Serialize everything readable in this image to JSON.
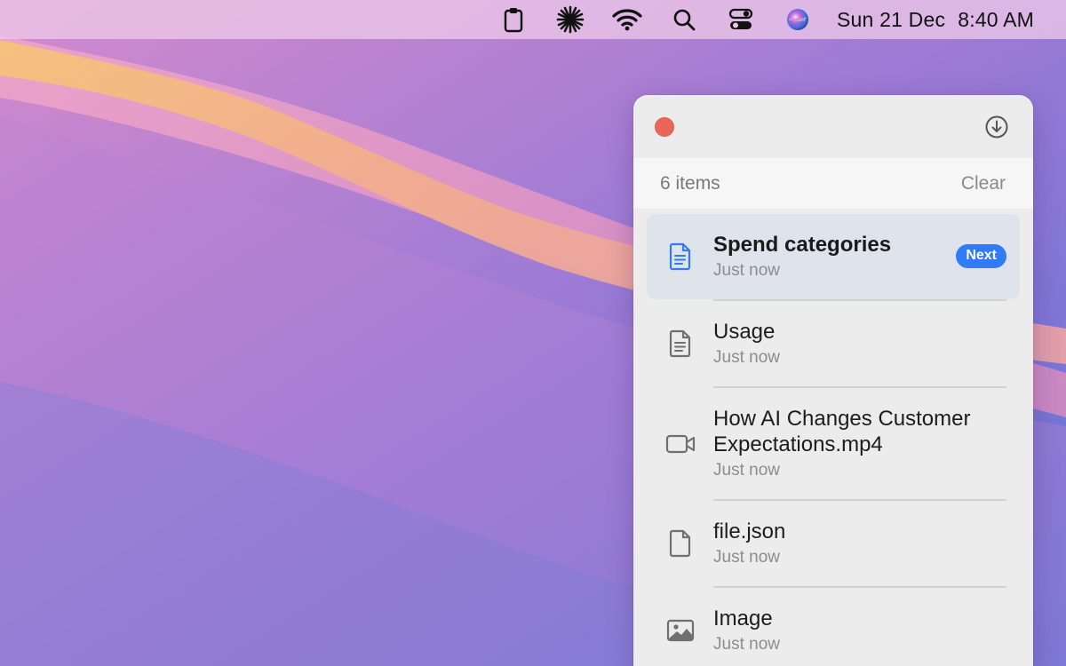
{
  "menubar": {
    "icons": [
      "clipboard-icon",
      "asterisk-app-icon",
      "wifi-icon",
      "search-icon",
      "control-center-icon",
      "siri-icon"
    ],
    "date": "Sun 21 Dec",
    "time": "8:40 AM"
  },
  "panel": {
    "item_count": "6 items",
    "clear_label": "Clear",
    "items": [
      {
        "title": "Spend categories",
        "subtitle": "Just now",
        "icon": "document-icon",
        "badge": "Next",
        "selected": true
      },
      {
        "title": "Usage",
        "subtitle": "Just now",
        "icon": "document-icon"
      },
      {
        "title": "How AI Changes Customer Expectations.mp4",
        "subtitle": "Just now",
        "icon": "video-icon"
      },
      {
        "title": "file.json",
        "subtitle": "Just now",
        "icon": "blank-file-icon"
      },
      {
        "title": "Image",
        "subtitle": "Just now",
        "icon": "image-icon"
      }
    ]
  },
  "colors": {
    "accent": "#2f7cf5",
    "close": "#ec6559",
    "selected_row": "#dfe3ec"
  }
}
